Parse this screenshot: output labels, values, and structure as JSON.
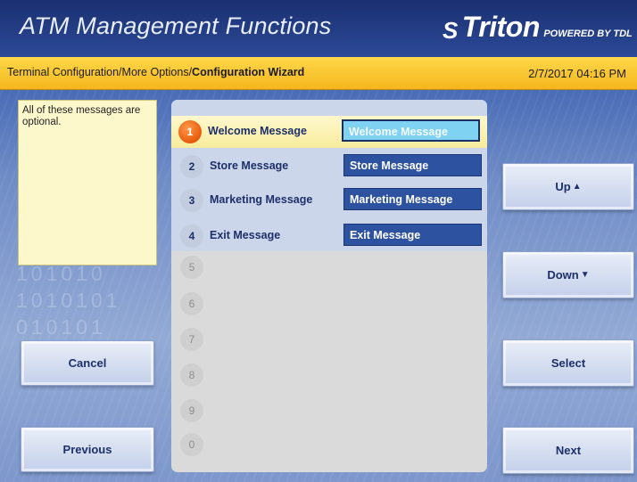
{
  "header": {
    "title": "ATM Management Functions",
    "logo_mark": "S",
    "logo_text": "Triton",
    "logo_sub": "POWERED BY TDL"
  },
  "breadcrumb": {
    "path": "Terminal Configuration/More Options/",
    "current": "Configuration Wizard"
  },
  "datetime": "2/7/2017  04:16 PM",
  "note": "All of these messages are optional.",
  "binary_watermark": [
    "101010",
    "1010101",
    "010101"
  ],
  "messages": [
    {
      "num": "1",
      "label": "Welcome Message",
      "value": "Welcome Message"
    },
    {
      "num": "2",
      "label": "Store Message",
      "value": "Store Message"
    },
    {
      "num": "3",
      "label": "Marketing Message",
      "value": "Marketing Message"
    },
    {
      "num": "4",
      "label": "Exit Message",
      "value": "Exit Message"
    }
  ],
  "empty_slots": [
    "5",
    "6",
    "7",
    "8",
    "9",
    "0"
  ],
  "buttons": {
    "cancel": "Cancel",
    "previous": "Previous",
    "up": "Up",
    "down": "Down",
    "select": "Select",
    "next": "Next"
  },
  "colors": {
    "header_bg": "#2c4a98",
    "crumb_bar": "#f3b61d",
    "field_bg": "#2d52a0",
    "selected_field_bg": "#7fd2f1",
    "selected_number": "#e85a0c"
  }
}
